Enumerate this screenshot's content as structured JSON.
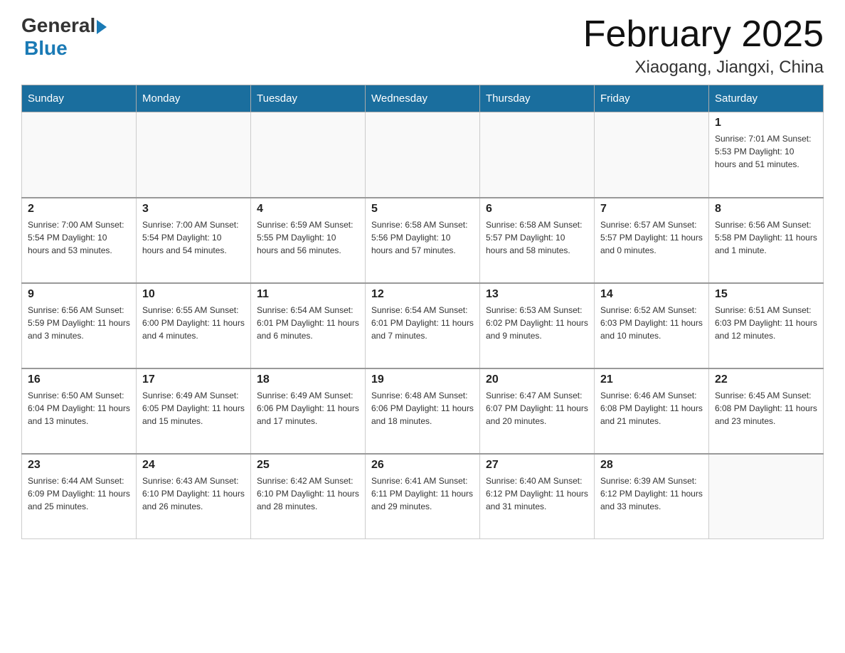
{
  "header": {
    "logo_general": "General",
    "logo_blue": "Blue",
    "month_title": "February 2025",
    "location": "Xiaogang, Jiangxi, China"
  },
  "days_of_week": [
    "Sunday",
    "Monday",
    "Tuesday",
    "Wednesday",
    "Thursday",
    "Friday",
    "Saturday"
  ],
  "weeks": [
    [
      {
        "day": "",
        "info": ""
      },
      {
        "day": "",
        "info": ""
      },
      {
        "day": "",
        "info": ""
      },
      {
        "day": "",
        "info": ""
      },
      {
        "day": "",
        "info": ""
      },
      {
        "day": "",
        "info": ""
      },
      {
        "day": "1",
        "info": "Sunrise: 7:01 AM\nSunset: 5:53 PM\nDaylight: 10 hours and 51 minutes."
      }
    ],
    [
      {
        "day": "2",
        "info": "Sunrise: 7:00 AM\nSunset: 5:54 PM\nDaylight: 10 hours and 53 minutes."
      },
      {
        "day": "3",
        "info": "Sunrise: 7:00 AM\nSunset: 5:54 PM\nDaylight: 10 hours and 54 minutes."
      },
      {
        "day": "4",
        "info": "Sunrise: 6:59 AM\nSunset: 5:55 PM\nDaylight: 10 hours and 56 minutes."
      },
      {
        "day": "5",
        "info": "Sunrise: 6:58 AM\nSunset: 5:56 PM\nDaylight: 10 hours and 57 minutes."
      },
      {
        "day": "6",
        "info": "Sunrise: 6:58 AM\nSunset: 5:57 PM\nDaylight: 10 hours and 58 minutes."
      },
      {
        "day": "7",
        "info": "Sunrise: 6:57 AM\nSunset: 5:57 PM\nDaylight: 11 hours and 0 minutes."
      },
      {
        "day": "8",
        "info": "Sunrise: 6:56 AM\nSunset: 5:58 PM\nDaylight: 11 hours and 1 minute."
      }
    ],
    [
      {
        "day": "9",
        "info": "Sunrise: 6:56 AM\nSunset: 5:59 PM\nDaylight: 11 hours and 3 minutes."
      },
      {
        "day": "10",
        "info": "Sunrise: 6:55 AM\nSunset: 6:00 PM\nDaylight: 11 hours and 4 minutes."
      },
      {
        "day": "11",
        "info": "Sunrise: 6:54 AM\nSunset: 6:01 PM\nDaylight: 11 hours and 6 minutes."
      },
      {
        "day": "12",
        "info": "Sunrise: 6:54 AM\nSunset: 6:01 PM\nDaylight: 11 hours and 7 minutes."
      },
      {
        "day": "13",
        "info": "Sunrise: 6:53 AM\nSunset: 6:02 PM\nDaylight: 11 hours and 9 minutes."
      },
      {
        "day": "14",
        "info": "Sunrise: 6:52 AM\nSunset: 6:03 PM\nDaylight: 11 hours and 10 minutes."
      },
      {
        "day": "15",
        "info": "Sunrise: 6:51 AM\nSunset: 6:03 PM\nDaylight: 11 hours and 12 minutes."
      }
    ],
    [
      {
        "day": "16",
        "info": "Sunrise: 6:50 AM\nSunset: 6:04 PM\nDaylight: 11 hours and 13 minutes."
      },
      {
        "day": "17",
        "info": "Sunrise: 6:49 AM\nSunset: 6:05 PM\nDaylight: 11 hours and 15 minutes."
      },
      {
        "day": "18",
        "info": "Sunrise: 6:49 AM\nSunset: 6:06 PM\nDaylight: 11 hours and 17 minutes."
      },
      {
        "day": "19",
        "info": "Sunrise: 6:48 AM\nSunset: 6:06 PM\nDaylight: 11 hours and 18 minutes."
      },
      {
        "day": "20",
        "info": "Sunrise: 6:47 AM\nSunset: 6:07 PM\nDaylight: 11 hours and 20 minutes."
      },
      {
        "day": "21",
        "info": "Sunrise: 6:46 AM\nSunset: 6:08 PM\nDaylight: 11 hours and 21 minutes."
      },
      {
        "day": "22",
        "info": "Sunrise: 6:45 AM\nSunset: 6:08 PM\nDaylight: 11 hours and 23 minutes."
      }
    ],
    [
      {
        "day": "23",
        "info": "Sunrise: 6:44 AM\nSunset: 6:09 PM\nDaylight: 11 hours and 25 minutes."
      },
      {
        "day": "24",
        "info": "Sunrise: 6:43 AM\nSunset: 6:10 PM\nDaylight: 11 hours and 26 minutes."
      },
      {
        "day": "25",
        "info": "Sunrise: 6:42 AM\nSunset: 6:10 PM\nDaylight: 11 hours and 28 minutes."
      },
      {
        "day": "26",
        "info": "Sunrise: 6:41 AM\nSunset: 6:11 PM\nDaylight: 11 hours and 29 minutes."
      },
      {
        "day": "27",
        "info": "Sunrise: 6:40 AM\nSunset: 6:12 PM\nDaylight: 11 hours and 31 minutes."
      },
      {
        "day": "28",
        "info": "Sunrise: 6:39 AM\nSunset: 6:12 PM\nDaylight: 11 hours and 33 minutes."
      },
      {
        "day": "",
        "info": ""
      }
    ]
  ]
}
